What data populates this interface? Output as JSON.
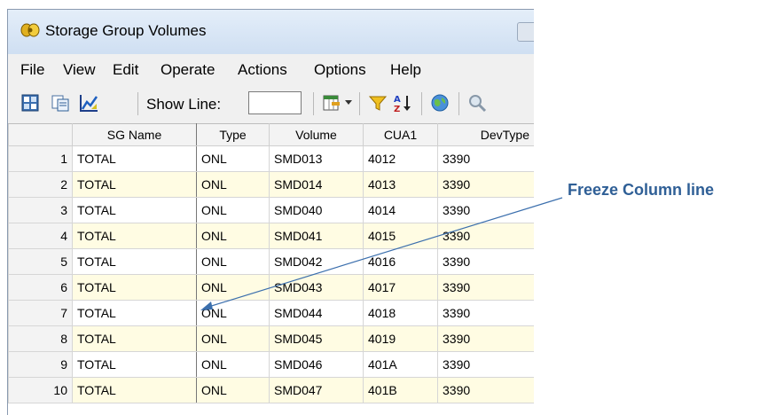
{
  "window": {
    "title": "Storage Group Volumes"
  },
  "menu": [
    "File",
    "View",
    "Edit",
    "Operate",
    "Actions",
    "Options",
    "Help"
  ],
  "toolbar": {
    "show_line_label": "Show Line:",
    "show_line_value": ""
  },
  "table": {
    "columns": [
      "",
      "SG Name",
      "Type",
      "Volume",
      "CUA1",
      "DevType"
    ],
    "rows": [
      [
        "1",
        "TOTAL",
        "ONL",
        "SMD013",
        "4012",
        "3390"
      ],
      [
        "2",
        "TOTAL",
        "ONL",
        "SMD014",
        "4013",
        "3390"
      ],
      [
        "3",
        "TOTAL",
        "ONL",
        "SMD040",
        "4014",
        "3390"
      ],
      [
        "4",
        "TOTAL",
        "ONL",
        "SMD041",
        "4015",
        "3390"
      ],
      [
        "5",
        "TOTAL",
        "ONL",
        "SMD042",
        "4016",
        "3390"
      ],
      [
        "6",
        "TOTAL",
        "ONL",
        "SMD043",
        "4017",
        "3390"
      ],
      [
        "7",
        "TOTAL",
        "ONL",
        "SMD044",
        "4018",
        "3390"
      ],
      [
        "8",
        "TOTAL",
        "ONL",
        "SMD045",
        "4019",
        "3390"
      ],
      [
        "9",
        "TOTAL",
        "ONL",
        "SMD046",
        "401A",
        "3390"
      ],
      [
        "10",
        "TOTAL",
        "ONL",
        "SMD047",
        "401B",
        "3390"
      ]
    ]
  },
  "annotation": {
    "text": "Freeze Column line",
    "color": "#2f5f96"
  },
  "icons": [
    "app-icon",
    "grid-view-icon",
    "copy-icon",
    "chart-icon",
    "column-chooser-icon",
    "filter-icon",
    "sort-az-icon",
    "globe-icon",
    "search-icon"
  ]
}
